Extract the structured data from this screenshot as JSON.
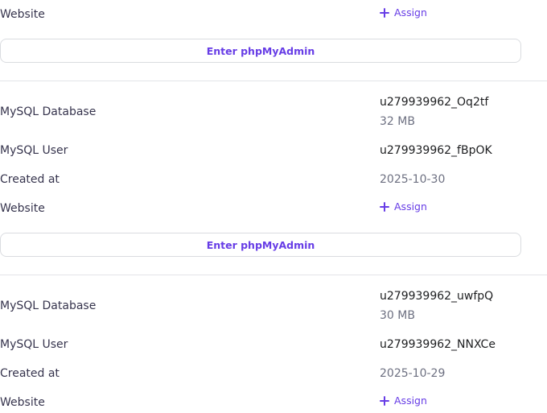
{
  "labels": {
    "mysql_database": "MySQL Database",
    "mysql_user": "MySQL User",
    "created_at": "Created at",
    "website": "Website"
  },
  "assign_label": "Assign",
  "enter_phpmyadmin_label": "Enter phpMyAdmin",
  "databases": [
    {
      "website_only": true
    },
    {
      "db_name": "u279939962_Oq2tf",
      "db_size": "32 MB",
      "user": "u279939962_fBpOK",
      "created_at": "2025-10-30"
    },
    {
      "db_name": "u279939962_uwfpQ",
      "db_size": "30 MB",
      "user": "u279939962_NNXCe",
      "created_at": "2025-10-29"
    }
  ],
  "colors": {
    "accent": "#673de6",
    "border": "#dadce0",
    "divider": "#e3e4e8"
  }
}
